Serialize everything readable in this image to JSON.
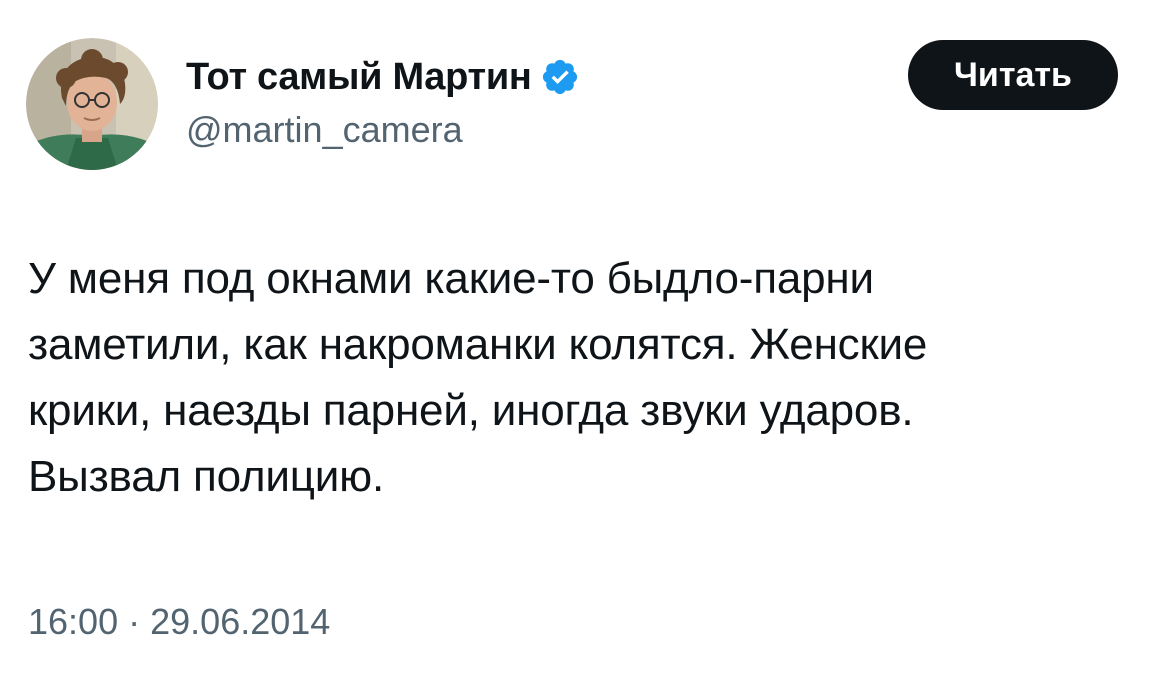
{
  "author": {
    "display_name": "Тот самый Мартин",
    "handle": "@martin_camera",
    "verified": true,
    "avatar": "profile-photo"
  },
  "follow_button": {
    "label": "Читать"
  },
  "tweet": {
    "lines": [
      "У меня под окнами какие-то быдло-парни",
      "заметили, как накроманки колятся. Женские",
      "крики, наезды парней, иногда звуки ударов.",
      "Вызвал полицию."
    ]
  },
  "meta": {
    "time": "16:00",
    "separator": "·",
    "date": "29.06.2014"
  },
  "colors": {
    "text": "#0f1419",
    "secondary": "#536471",
    "verified_badge": "#1d9bf0",
    "button_bg": "#0f1419"
  }
}
